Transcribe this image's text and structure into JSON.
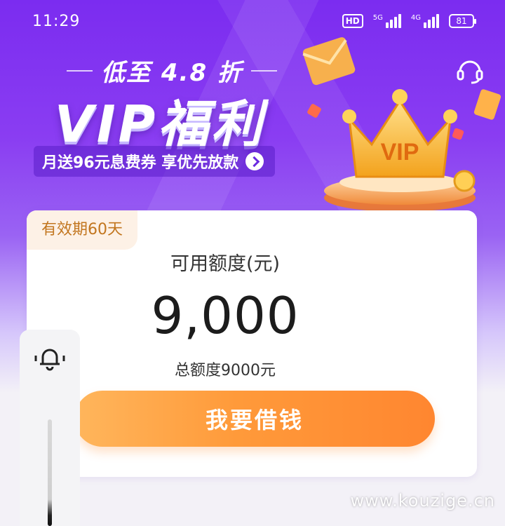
{
  "status_bar": {
    "time": "11:29",
    "hd": "HD",
    "signal_1": "5G",
    "signal_2": "4G",
    "battery": "81"
  },
  "banner": {
    "discount": "低至 4.8 折",
    "title": "VIP福利",
    "subtitle": "月送96元息费券 享优先放款",
    "crown_text": "VIP"
  },
  "card": {
    "validity": "有效期60天",
    "credit_label": "可用额度(元)",
    "credit_amount": "9,000",
    "credit_total": "总额度9000元",
    "borrow_button": "我要借钱"
  },
  "watermark": "www.kouzige.cn",
  "colors": {
    "primary_purple": "#7b2cf0",
    "button_orange": "#ff8e35",
    "tag_text": "#c2761f",
    "tag_bg": "#fdf1e6"
  },
  "icons": [
    "headset-icon",
    "crown-icon",
    "bell-icon",
    "chevron-right-icon"
  ]
}
